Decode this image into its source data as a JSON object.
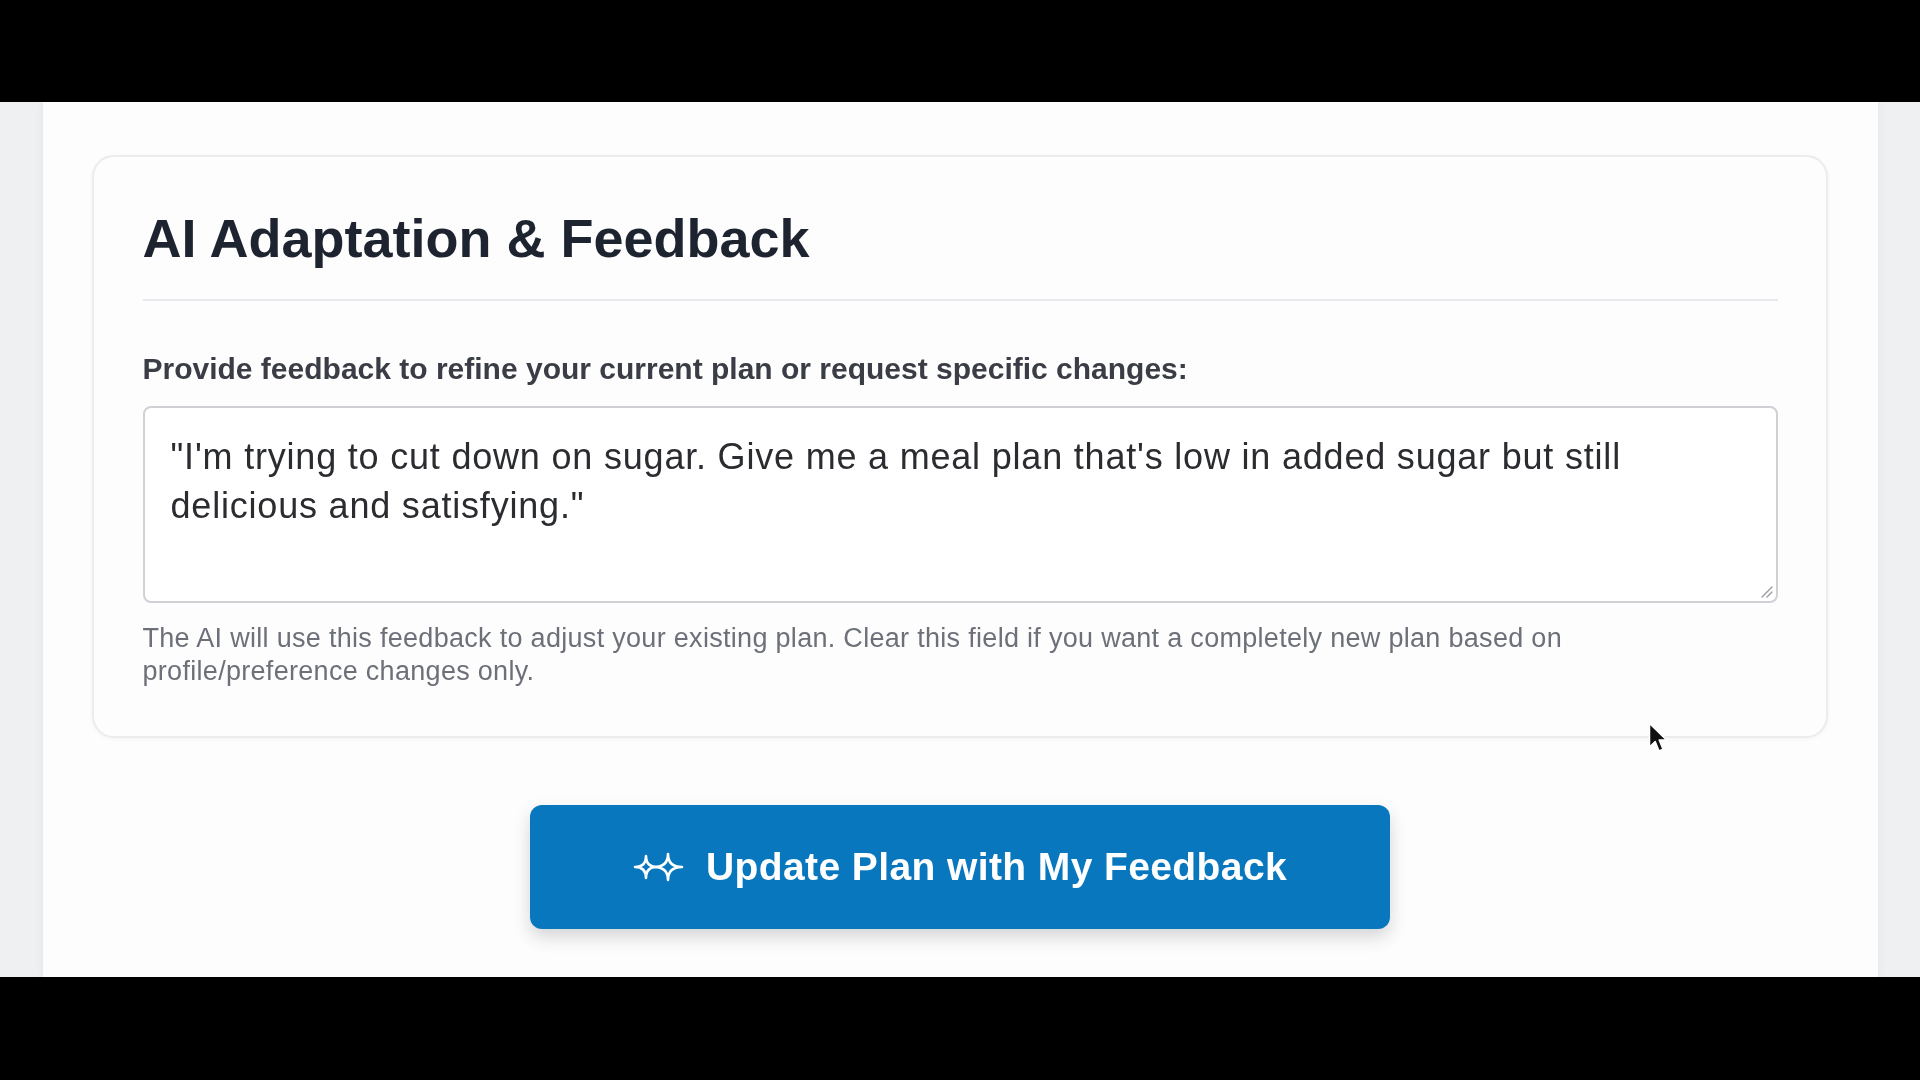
{
  "section": {
    "title": "AI Adaptation & Feedback",
    "feedback_field": {
      "label": "Provide feedback to refine your current plan or request specific changes:",
      "value": "\"I'm trying to cut down on sugar. Give me a meal plan that's low in added sugar but still delicious and satisfying.\"",
      "help_text": "The AI will use this feedback to adjust your existing plan. Clear this field if you want a completely new plan based on profile/preference changes only."
    }
  },
  "submit_button": {
    "label": "Update Plan with My Feedback"
  }
}
